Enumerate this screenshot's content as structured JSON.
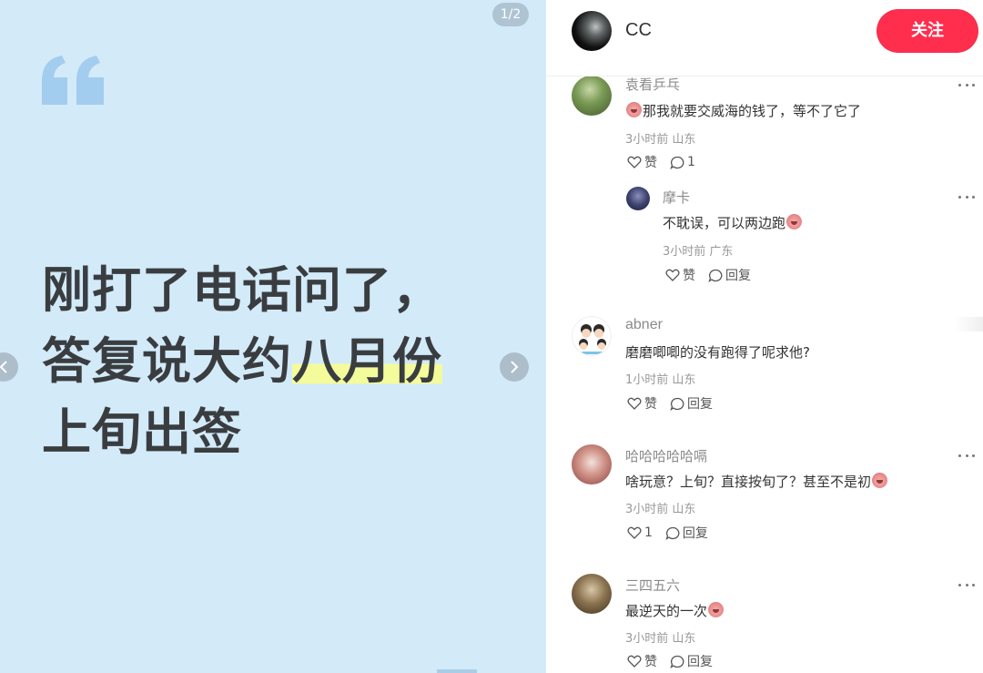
{
  "slide": {
    "page_indicator": "1/2",
    "lines": [
      "刚打了电话问了，",
      "答复说大约",
      "八月份",
      "上旬出签"
    ]
  },
  "author": {
    "name": "CC",
    "follow_label": "关注"
  },
  "actions": {
    "like_label": "赞",
    "reply_label": "回复"
  },
  "comments": [
    {
      "name": "袁看乒乓",
      "text": "那我就要交威海的钱了，等不了它了",
      "meta": "3小时前 山东",
      "likes": "",
      "replies": "1"
    },
    {
      "name": "摩卡",
      "text": "不耽误，可以两边跑",
      "meta": "3小时前 广东",
      "likes": "",
      "replies": ""
    },
    {
      "name": "abner",
      "text": "磨磨唧唧的没有跑得了呢求他?",
      "meta": "1小时前 山东",
      "likes": "",
      "replies": ""
    },
    {
      "name": "哈哈哈哈哈嗝",
      "text": "啥玩意？上旬？直接按旬了？甚至不是初",
      "meta": "3小时前 山东",
      "likes": "1",
      "replies": ""
    },
    {
      "name": "三四五六",
      "text": "最逆天的一次",
      "meta": "3小时前 山东",
      "likes": "",
      "replies": ""
    }
  ],
  "colors": {
    "follow": "#ff2e4d",
    "slide_bg": "#d3eaf9",
    "highlight": "#f4fb9a"
  }
}
